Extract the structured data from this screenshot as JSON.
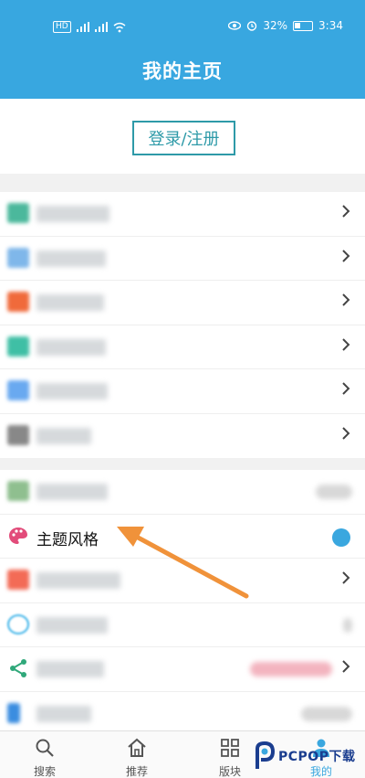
{
  "status_bar": {
    "left_chip": "HD",
    "battery": "32%",
    "time": "3:34"
  },
  "header": {
    "title": "我的主页"
  },
  "login": {
    "label": "登录/注册"
  },
  "group1": {
    "items": [
      {
        "icon_color": "#4bb89c"
      },
      {
        "icon_color": "#7fb7ea"
      },
      {
        "icon_color": "#f06a3b"
      },
      {
        "icon_color": "#3fbfa5"
      },
      {
        "icon_color": "#69a9f0"
      },
      {
        "icon_color": "#888888"
      }
    ]
  },
  "group2": {
    "items": [
      {
        "icon_color": "#8fbf8f"
      },
      {
        "label": "主题风格",
        "icon": "palette-icon",
        "icon_color": "#e24b7a",
        "value_color": "#3aa7df"
      },
      {
        "icon_color": "#f36b56"
      },
      {
        "icon_color": "#3ab2e8"
      },
      {
        "icon_color": "#2fa87a"
      },
      {
        "icon_color": "#3a8de0"
      }
    ]
  },
  "tabbar": {
    "tabs": [
      {
        "label": "搜索",
        "icon": "search-icon"
      },
      {
        "label": "推荐",
        "icon": "home-icon"
      },
      {
        "label": "版块",
        "icon": "grid-icon"
      },
      {
        "label": "我的",
        "icon": "person-icon",
        "active_color": "#3aa7df"
      }
    ]
  },
  "watermark": {
    "brand": "PCPOP下载"
  },
  "annotation": {
    "arrow_color": "#f0923a"
  }
}
